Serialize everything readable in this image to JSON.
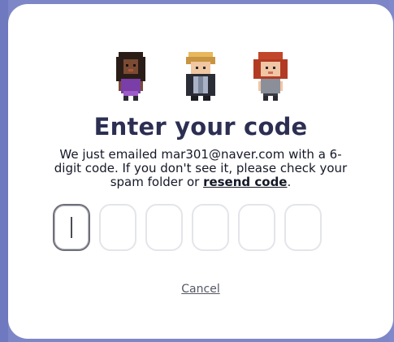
{
  "modal": {
    "avatars": [
      "avatar-1",
      "avatar-2",
      "avatar-3"
    ],
    "title": "Enter your code",
    "message_prefix": "We just emailed mar301@naver.com with a 6-digit code. If you don't see it, please check your spam folder or ",
    "resend_link": "resend code",
    "message_suffix": ".",
    "code_inputs": [
      "",
      "",
      "",
      "",
      "",
      ""
    ],
    "cancel_label": "Cancel"
  },
  "colors": {
    "backdrop": "#7d86c6",
    "title": "#2c2f52",
    "input_border": "#e4e5ea",
    "input_active_border": "#6e6f78"
  }
}
